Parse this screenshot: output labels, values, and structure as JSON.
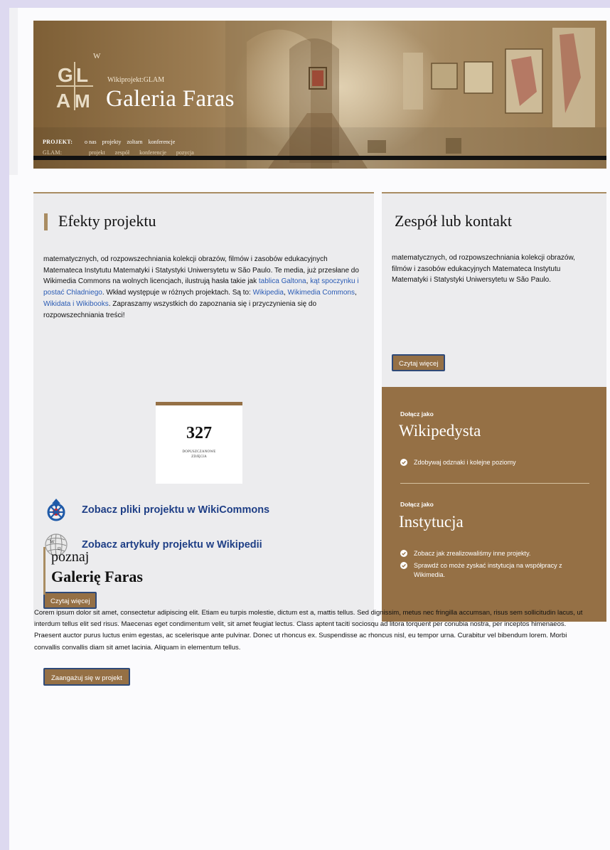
{
  "header": {
    "logo_letter_mark": "GLAM",
    "logo_superscript": "W",
    "subtitle": "Wikiprojekt:GLAM",
    "title": "Galeria Faras",
    "nav_project_label": "PROJEKT:",
    "nav_project_items": [
      "o nas",
      "projekty",
      "zoltarn",
      "konferencje"
    ],
    "nav_glam_label": "GLAM:",
    "nav_glam_items": [
      "projekt",
      "zespół",
      "konferencje",
      "pozycja"
    ]
  },
  "effects": {
    "heading": "Efekty projektu",
    "para_1": "matematycznych, od rozpowszechniania kolekcji obrazów, filmów i zasobów edukacyjnych Matemateca Instytutu Matematyki i Statystyki Uniwersytetu w São Paulo. Te media, już przesłane do Wikimedia Commons na wolnych licencjach, ilustrują hasła takie jak ",
    "link_1": "tablica Galtona",
    "sep_1": ", ",
    "link_2": "kąt spoczynku i postać Chladniego",
    "para_2": ". Wkład występuje w różnych projektach. Są to: ",
    "link_3": "Wikipedia",
    "sep_2": ", ",
    "link_4": "Wikimedia Commons",
    "sep_3": ", ",
    "link_5": "Wikidata i Wikibooks",
    "para_3": ". Zapraszamy wszystkich do zapoznania się i przyczynienia się do rozpowszechniania treści!",
    "stat_value": "327",
    "stat_label": "DOPUSZCZANOWE ZDJĘCIA",
    "commons_link": "Zobacz pliki projektu w WikiCommons",
    "wikipedia_link": "Zobacz artykuły projektu w Wikipedii",
    "read_more": "Czytaj więcej"
  },
  "team": {
    "heading": "Zespół lub kontakt",
    "para": "matematycznych, od rozpowszechniania kolekcji obrazów, filmów i zasobów edukacyjnych Matemateca Instytutu Matematyki i Statystyki Uniwersytetu w São Paulo.",
    "read_more": "Czytaj więcej"
  },
  "join": {
    "kicker_1": "Dołącz jako",
    "title_1": "Wikipedysta",
    "items_1": [
      "Zdobywaj odznaki i kolejne poziomy"
    ],
    "kicker_2": "Dołącz jako",
    "title_2": "Instytucja",
    "items_2": [
      "Zobacz jak zrealizowaliśmy inne projekty.",
      "Sprawdź co może zyskać instytucja na współpracy z Wikimedia."
    ]
  },
  "about": {
    "pre_title": "poznaj",
    "title": "Galerię Faras",
    "body": "Corem ipsum dolor sit amet, consectetur adipiscing elit. Etiam eu turpis molestie, dictum est a, mattis tellus. Sed dignissim, metus nec fringilla accumsan, risus sem sollicitudin lacus, ut interdum tellus elit sed risus. Maecenas eget condimentum velit, sit amet feugiat lectus. Class aptent taciti sociosqu ad litora torquent per conubia nostra, per inceptos himenaeos. Praesent auctor purus luctus enim egestas, ac scelerisque ante pulvinar. Donec ut rhoncus ex. Suspendisse ac rhoncus nisl, eu tempor urna. Curabitur vel bibendum lorem. Morbi convallis convallis diam sit amet lacinia. Aliquam in elementum tellus.",
    "cta": "Zaangażuj się w projekt"
  },
  "colors": {
    "accent": "#957045",
    "accent_light": "#a98c62",
    "link": "#2a5bb4",
    "link_dark": "#1f3f86",
    "button_border": "#2f4a78"
  }
}
